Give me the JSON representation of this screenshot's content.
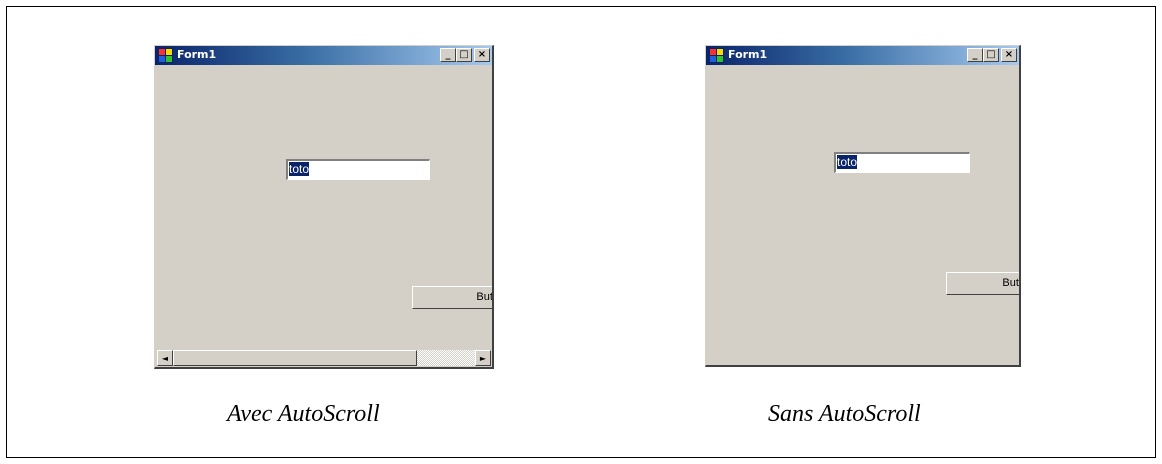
{
  "left_window": {
    "title": "Form1",
    "textbox_value": "toto",
    "button_label": "Butt",
    "caption": "Avec AutoScroll",
    "scrollbar": {
      "left_arrow": "◄",
      "right_arrow": "►"
    }
  },
  "right_window": {
    "title": "Form1",
    "textbox_value": "toto",
    "button_label": "Butt",
    "caption": "Sans AutoScroll"
  },
  "caption_buttons": {
    "minimize": "_",
    "maximize": "□",
    "close": "×"
  },
  "icons": {
    "app": "form-app-icon"
  },
  "colors": {
    "window_face": "#d4d0c8",
    "title_start": "#0a246a",
    "title_end": "#a6caf0",
    "selection": "#0a246a"
  }
}
